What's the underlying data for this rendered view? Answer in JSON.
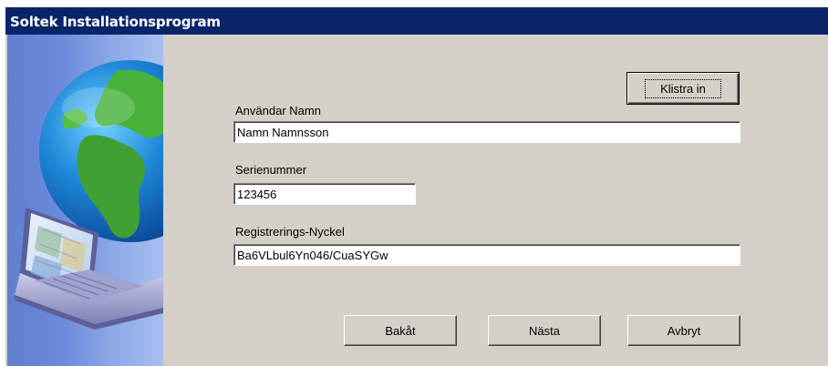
{
  "window": {
    "title": "Soltek Installationsprogram"
  },
  "form": {
    "paste_button": "Klistra in",
    "username_label": "Användar Namn",
    "username_value": "Namn Namnsson",
    "serial_label": "Serienummer",
    "serial_value": "123456",
    "regkey_label": "Registrerings-Nyckel",
    "regkey_value": "Ba6VLbul6Yn046/CuaSYGw"
  },
  "buttons": {
    "back": "Bakåt",
    "next": "Nästa",
    "cancel": "Avbryt"
  },
  "colors": {
    "titlebar": "#0a246a",
    "face": "#d4d0c8",
    "side_panel": "#7090dd"
  },
  "icons": {
    "side_illustration": "globe-laptop-icon"
  }
}
